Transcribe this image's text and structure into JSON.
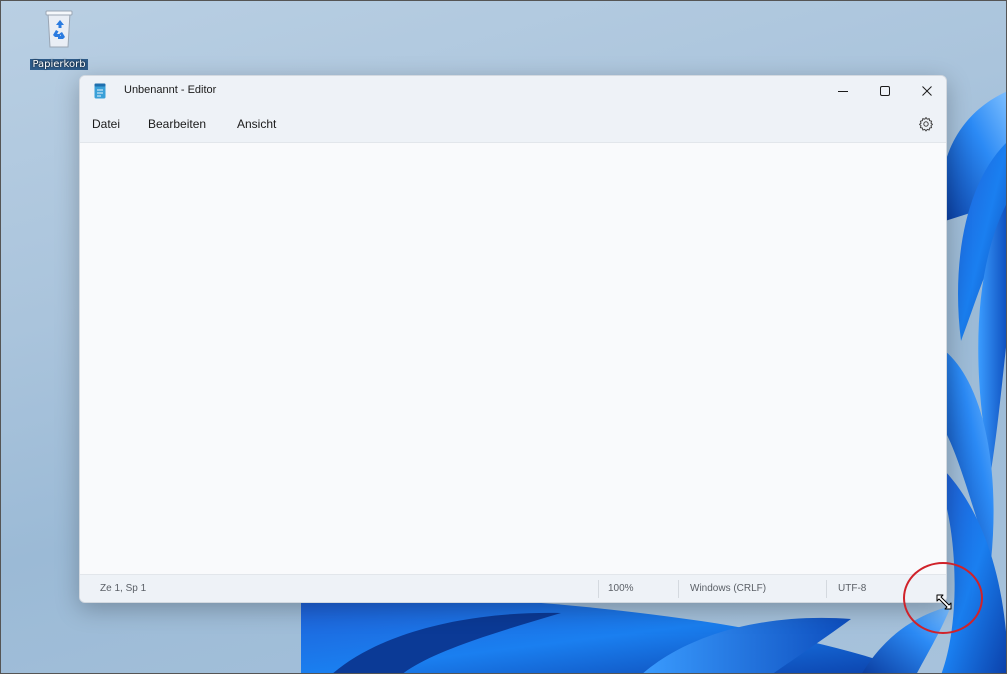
{
  "desktop": {
    "recycle_bin_label": "Papierkorb"
  },
  "window": {
    "title": "Unbenannt - Editor",
    "app_icon": "notepad-icon",
    "controls": {
      "minimize": "minimize-icon",
      "maximize": "maximize-icon",
      "close": "close-icon"
    }
  },
  "menu": {
    "items": [
      {
        "label": "Datei"
      },
      {
        "label": "Bearbeiten"
      },
      {
        "label": "Ansicht"
      }
    ],
    "settings_icon": "gear-icon"
  },
  "editor": {
    "content": ""
  },
  "statusbar": {
    "position": "Ze 1, Sp 1",
    "zoom": "100%",
    "line_ending": "Windows (CRLF)",
    "encoding": "UTF-8"
  },
  "annotation": {
    "highlight_color": "#d0222a",
    "cursor": "resize-diagonal-cursor"
  },
  "colors": {
    "accent": "#1a6fe0",
    "window_bg": "#f9fafc",
    "bar_bg": "#eef2f7"
  }
}
